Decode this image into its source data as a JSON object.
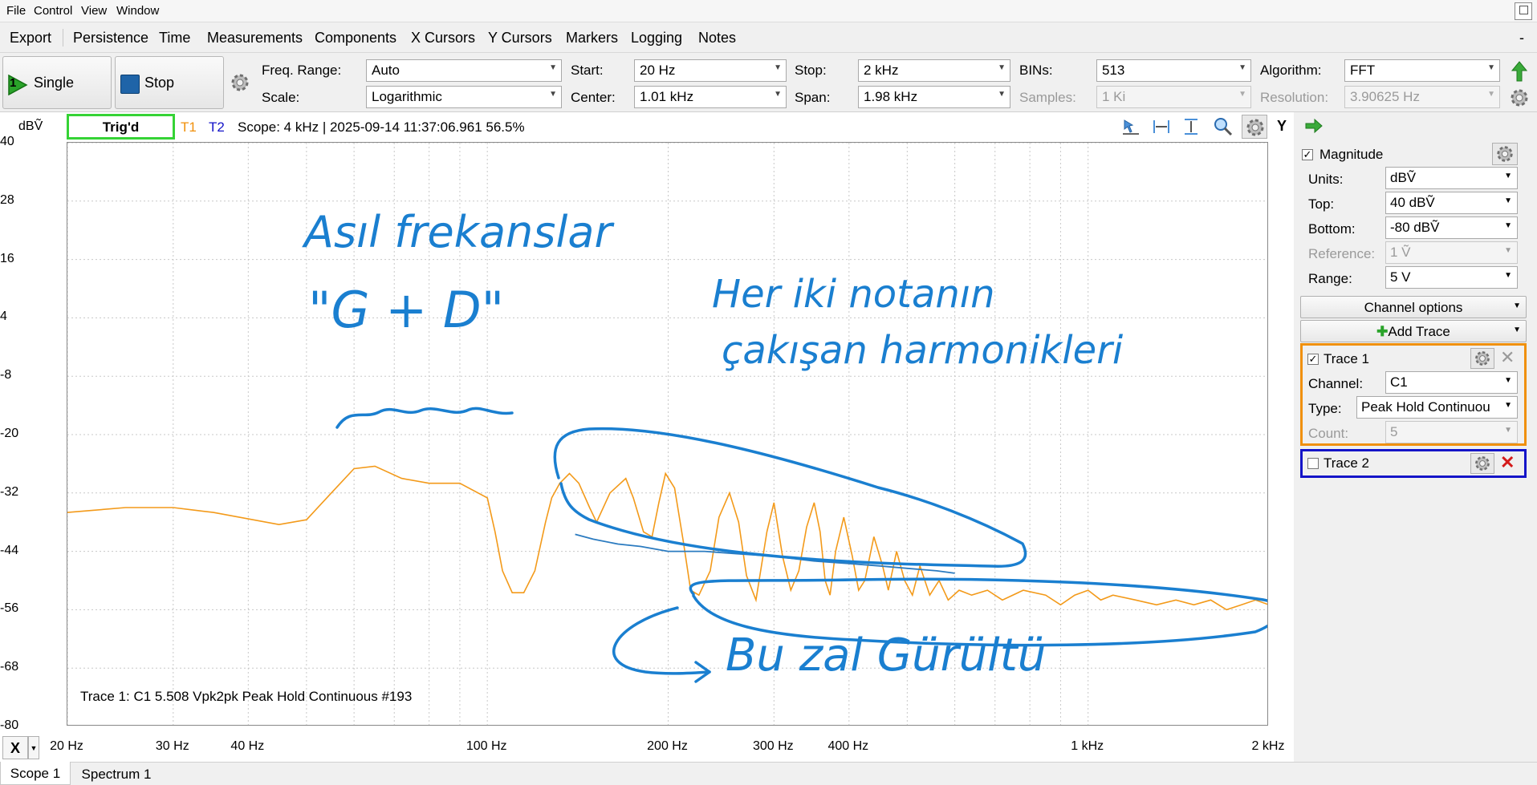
{
  "menu": [
    "File",
    "Control",
    "View",
    "Window"
  ],
  "tabs": [
    "Export",
    "Persistence",
    "Time",
    "Measurements",
    "Components",
    "X Cursors",
    "Y Cursors",
    "Markers",
    "Logging",
    "Notes"
  ],
  "tabs_minimize": "-",
  "toolbar": {
    "single_label": "Single",
    "single_badge": "1",
    "stop_label": "Stop",
    "freq_range_label": "Freq. Range:",
    "freq_range_value": "Auto",
    "scale_label": "Scale:",
    "scale_value": "Logarithmic",
    "start_label": "Start:",
    "start_value": "20 Hz",
    "center_label": "Center:",
    "center_value": "1.01 kHz",
    "stop_freq_label": "Stop:",
    "stop_freq_value": "2 kHz",
    "span_label": "Span:",
    "span_value": "1.98 kHz",
    "bins_label": "BINs:",
    "bins_value": "513",
    "samples_label": "Samples:",
    "samples_value": "1 Ki",
    "algorithm_label": "Algorithm:",
    "algorithm_value": "FFT",
    "resolution_label": "Resolution:",
    "resolution_value": "3.90625 Hz"
  },
  "plot": {
    "unit": "dBṼ",
    "trig": "Trig'd",
    "t1": "T1",
    "t2": "T2",
    "status": "Scope: 4 kHz | 2025-09-14 11:37:06.961 56.5%",
    "y_axis_btn": "Y",
    "x_axis_btn": "X",
    "y_ticks": [
      "40",
      "28",
      "16",
      "4",
      "-8",
      "-20",
      "-32",
      "-44",
      "-56",
      "-68",
      "-80"
    ],
    "x_ticks": [
      "20 Hz",
      "30 Hz",
      "40 Hz",
      "100 Hz",
      "200 Hz",
      "300 Hz",
      "400 Hz",
      "1 kHz",
      "2 kHz"
    ],
    "trace_info": "Trace 1: C1 5.508 Vpk2pk Peak Hold Continuous #193",
    "annotations": {
      "a1": "Asıl frekanslar",
      "a2": "\"G + D\"",
      "a3": "Her iki notanın",
      "a4": "çakışan harmonikleri",
      "a5": "Bu zal Gürültü"
    },
    "colors": {
      "trace1": "#f39a1a",
      "trace2": "#2b7bc0",
      "ink": "#1a7fd0"
    }
  },
  "chart_data": {
    "type": "line",
    "xlabel": "",
    "ylabel": "dBṼ",
    "xscale": "log",
    "xlim": [
      20,
      2000
    ],
    "ylim": [
      -80,
      40
    ],
    "series": [
      {
        "name": "T1",
        "x": [
          20,
          25,
          30,
          35,
          45,
          50,
          55,
          60,
          65,
          72,
          80,
          90,
          100,
          103,
          106,
          110,
          115,
          120,
          125,
          128,
          132,
          137,
          142,
          148,
          152,
          160,
          170,
          175,
          182,
          188,
          193,
          198,
          205,
          212,
          218,
          225,
          235,
          243,
          253,
          262,
          270,
          280,
          292,
          300,
          310,
          320,
          330,
          340,
          350,
          358,
          365,
          372,
          380,
          392,
          405,
          415,
          425,
          440,
          455,
          465,
          480,
          495,
          510,
          525,
          545,
          565,
          585,
          610,
          640,
          680,
          720,
          780,
          850,
          900,
          950,
          1000,
          1050,
          1100,
          1200,
          1300,
          1400,
          1500,
          1600,
          1700,
          1800,
          1900,
          2000
        ],
        "y": [
          -36,
          -35,
          -35,
          -36,
          -38.5,
          -37.5,
          -32,
          -27,
          -26.5,
          -29,
          -30,
          -30,
          -33,
          -40,
          -48,
          -52.5,
          -52.5,
          -48,
          -38,
          -33,
          -30,
          -28,
          -30,
          -35,
          -38,
          -32,
          -29,
          -33,
          -40,
          -41,
          -34,
          -28,
          -31,
          -42,
          -52,
          -53,
          -48,
          -37,
          -32,
          -38,
          -49,
          -54,
          -40,
          -34,
          -45,
          -52,
          -48,
          -39,
          -34,
          -40,
          -50,
          -53,
          -44,
          -37,
          -45,
          -52,
          -50,
          -41,
          -47,
          -52,
          -44,
          -50,
          -53,
          -47,
          -53,
          -50,
          -54,
          -52,
          -53,
          -52,
          -54,
          -52,
          -53,
          -55,
          -53,
          -52,
          -54,
          -53,
          -54,
          -55,
          -54,
          -55,
          -54,
          -56,
          -55,
          -54,
          -55
        ]
      },
      {
        "name": "T2",
        "x": [
          140,
          150,
          165,
          180,
          200,
          230,
          260,
          300,
          350,
          400,
          450,
          500,
          560,
          600
        ],
        "y": [
          -40.5,
          -41.5,
          -42.5,
          -43,
          -44,
          -44,
          -44.5,
          -45,
          -46,
          -46.5,
          -47,
          -47.5,
          -48,
          -48.5
        ]
      }
    ]
  },
  "magnitude": {
    "title": "Magnitude",
    "units_label": "Units:",
    "units_value": "dBṼ",
    "top_label": "Top:",
    "top_value": "40 dBṼ",
    "bottom_label": "Bottom:",
    "bottom_value": "-80 dBṼ",
    "reference_label": "Reference:",
    "reference_value": "1 Ṽ",
    "range_label": "Range:",
    "range_value": "5 V",
    "channel_options": "Channel options",
    "add_trace": "Add Trace"
  },
  "trace1": {
    "title": "Trace 1",
    "channel_label": "Channel:",
    "channel_value": "C1",
    "type_label": "Type:",
    "type_value": "Peak Hold Continuou",
    "count_label": "Count:",
    "count_value": "5",
    "border_color": "#f0900c"
  },
  "trace2": {
    "title": "Trace 2",
    "border_color": "#1414c8"
  },
  "bottom_tabs": [
    "Scope 1",
    "Spectrum 1"
  ]
}
